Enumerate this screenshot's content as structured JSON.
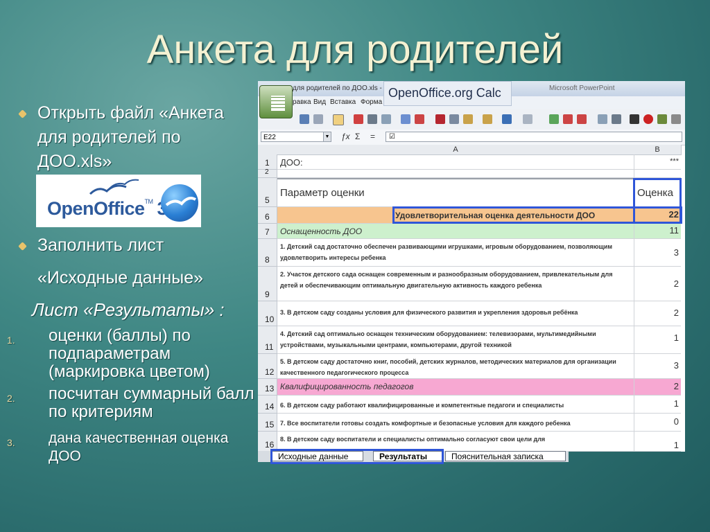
{
  "slide": {
    "title": "Анкета для родителей",
    "bullets": [
      "Открыть файл «Анкета для родителей по ДОО.xls»",
      "Заполнить лист",
      "«Исходные данные»"
    ],
    "results_heading": "Лист «Результаты» :",
    "results_items": [
      {
        "num": "1.",
        "text": "оценки (баллы) по подпараметрам (маркировка цветом)",
        "size": 24
      },
      {
        "num": "2.",
        "text": "посчитан суммарный балл по критериям",
        "size": 24
      },
      {
        "num": "3.",
        "text": "дана качественная оценка ДОО",
        "size": 21
      }
    ]
  },
  "logo": {
    "wordmark": "OpenOffice",
    "tm": "TM",
    "version": "3"
  },
  "calc": {
    "window_title": "для родителей по ДОО.xls - C",
    "window_title_right": "Microsoft PowerPoint",
    "badge": "OpenOffice.org Calc",
    "menu": [
      "равка",
      "Вид",
      "Вставка",
      "Форма"
    ],
    "namebox": "E22",
    "fx_glyph": "ƒx",
    "sum_glyph": "Σ",
    "eq_glyph": "=",
    "formula_value": "☑",
    "col_a": "A",
    "col_b": "B",
    "rows": [
      {
        "num": "1",
        "a": "ДОО:",
        "b": "***"
      },
      {
        "num": "2",
        "a": "",
        "b": ""
      },
      {
        "num": "5",
        "a": "Параметр оценки",
        "b": "Оценка"
      },
      {
        "num": "6",
        "a": "Удовлетворительная оценка деятельности ДОО",
        "b": "22"
      },
      {
        "num": "7",
        "a": "Оснащенность ДОО",
        "b": "11"
      },
      {
        "num": "8",
        "a": "1. Детский сад достаточно обеспечен развивающими игрушками, игровым оборудованием, позволяющим удовлетворить интересы ребенка",
        "b": "3"
      },
      {
        "num": "9",
        "a": "2. Участок детского сада оснащен современным и разнообразным оборудованием, привлекательным для детей и обеспечивающим оптимальную двигательную активность каждого ребенка",
        "b": "2"
      },
      {
        "num": "10",
        "a": "3. В детском саду созданы условия для физического развития и укрепления здоровья ребёнка",
        "b": "2"
      },
      {
        "num": "11",
        "a": "4. Детский сад оптимально оснащен техническим оборудованием: телевизорами, мультимедийными устройствами, музыкальными центрами, компьютерами, другой техникой",
        "b": "1"
      },
      {
        "num": "12",
        "a": "5. В детском саду достаточно книг, пособий, детских журналов, методических материалов для организации качественного педагогического процесса",
        "b": "3"
      },
      {
        "num": "13",
        "a": "Квалифицированность педагогов",
        "b": "2"
      },
      {
        "num": "14",
        "a": "6. В детском саду работают квалифицированные и компетентные педагоги и специалисты",
        "b": "1"
      },
      {
        "num": "15",
        "a": "7. Все воспитатели готовы создать комфортные и безопасные условия для каждого ребенка",
        "b": "0"
      },
      {
        "num": "16",
        "a": "8. В детском саду воспитатели и специалисты оптимально согласуют свои цели для",
        "b": "1"
      }
    ],
    "sheet_tabs": [
      "Исходные данные",
      "Результаты",
      "Пояснительная записка"
    ],
    "colors": {
      "header_orange": "#f7c58f",
      "green_band": "#cdf0cd",
      "pink_band": "#f7a8d2",
      "highlight_blue": "#2f56d8"
    }
  }
}
